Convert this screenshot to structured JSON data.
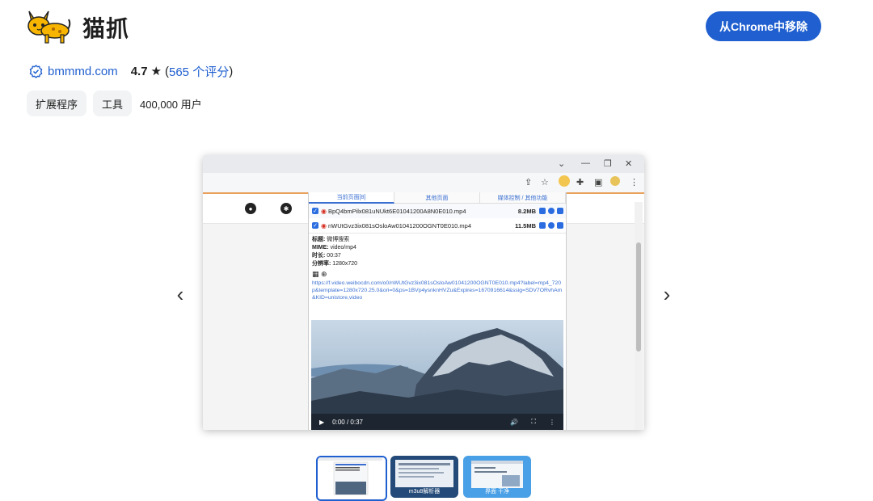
{
  "header": {
    "title": "猫抓",
    "logo_icon": "yellow-cat-logo",
    "remove_button": "从Chrome中移除",
    "accent": "#1f5fcf"
  },
  "meta": {
    "domain": "bmmmd.com",
    "rating": "4.7",
    "star": "★",
    "ratings_open": "(",
    "ratings_count": "565 个评分",
    "ratings_close": ")"
  },
  "chips": {
    "category1": "扩展程序",
    "category2": "工具",
    "users": "400,000 用户"
  },
  "carousel": {
    "prev": "‹",
    "next": "›"
  },
  "screenshot": {
    "tabs": [
      "当前页面[8]",
      "其他页面",
      "媒体控制 / 其他功能"
    ],
    "files": [
      {
        "name": "BpQ4bmPilx081uNUkt6E01041200A8N0E010.mp4",
        "size": "8.2MB"
      },
      {
        "name": "nWUtGvz3ix081sOsloAw01041200OGNT0E010.mp4",
        "size": "11.5MB"
      }
    ],
    "info": {
      "title_label": "标题:",
      "title_value": "微博搜索",
      "mime_label": "MIME:",
      "mime_value": "video/mp4",
      "duration_label": "时长:",
      "duration_value": "00:37",
      "resolution_label": "分辨率:",
      "resolution_value": "1280x720"
    },
    "url": "https://f.video.weibocdn.com/o0/nWUtGvz3ix081sOsloAw01041200OGNT0E010.mp4?label=mp4_720p&template=1280x720.25.0&ori=0&ps=1BVp4ysnknHVZu&Expires=1670916614&ssig=SDV7ORvhAm&KID=unistore,video",
    "video_time": "0:00 / 0:37"
  },
  "thumbnails": {
    "thumb2_caption": "m3u8解析器",
    "thumb3_caption": "界面 干净"
  }
}
